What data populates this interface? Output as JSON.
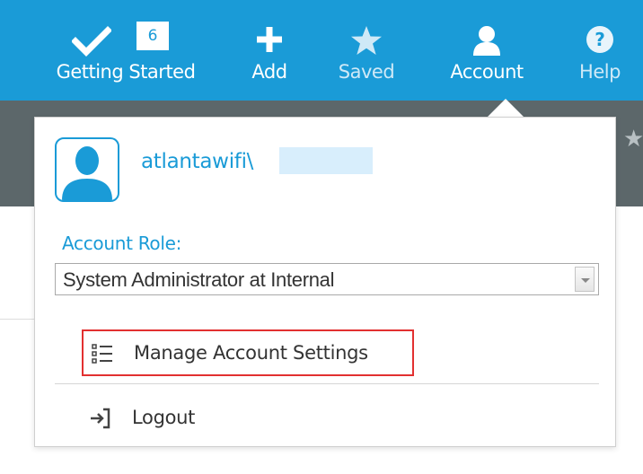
{
  "nav": {
    "getting_started": {
      "label": "Getting Started",
      "count": "6",
      "icon": "checkmark-icon"
    },
    "add": {
      "label": "Add",
      "icon": "plus-icon"
    },
    "saved": {
      "label": "Saved",
      "icon": "star-icon"
    },
    "account": {
      "label": "Account",
      "icon": "user-icon"
    },
    "help": {
      "label": "Help",
      "icon": "question-icon"
    }
  },
  "account_menu": {
    "username": "atlantawifi\\",
    "role_label": "Account Role:",
    "role_value": "System Administrator at Internal",
    "items": [
      {
        "label": "Manage Account Settings",
        "icon": "list-icon"
      },
      {
        "label": "Logout",
        "icon": "logout-icon"
      }
    ]
  },
  "colors": {
    "accent": "#1a9bd7",
    "subbar": "#5c676a",
    "highlight_border": "#e23030"
  }
}
